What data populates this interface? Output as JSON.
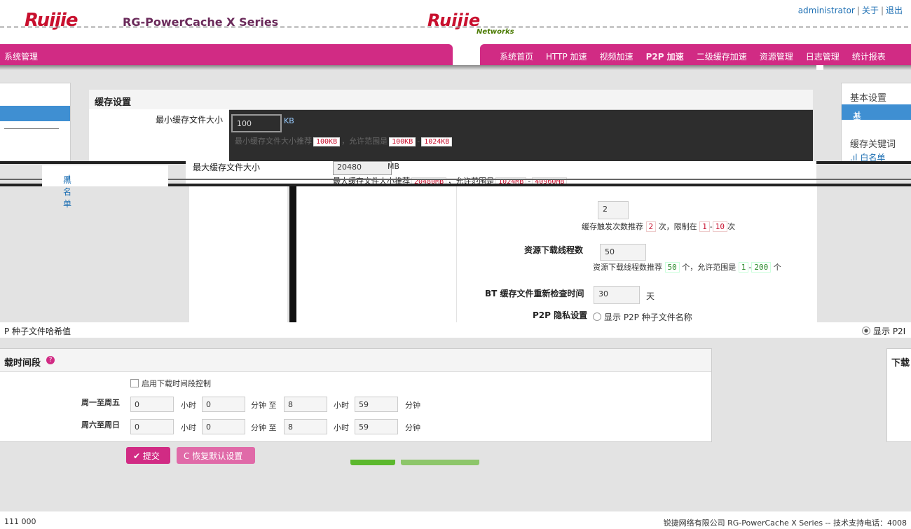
{
  "header": {
    "logo": "Ruijie",
    "product": "RG-PowerCache X Series",
    "brand2": "Ruijie",
    "networks": "Networks",
    "user": "administrator",
    "about": "关于",
    "logout": "退出",
    "sep": "|"
  },
  "nav": {
    "left_title": "系统管理",
    "items": [
      "系统首页",
      "HTTP 加速",
      "视频加速",
      "P2P 加速",
      "二级缓存加速",
      "资源管理",
      "日志管理",
      "统计报表"
    ]
  },
  "left_sidebar": {
    "blacklist": "黑名单"
  },
  "right_sidebar": {
    "basic_heading": "基本设置",
    "basic_selected": "基本设置",
    "keyword_heading": "缓存关键词",
    "whitelist": "白名单",
    "bar_icon": "signal-bars-icon"
  },
  "cache_settings": {
    "title": "缓存设置",
    "min_label": "最小缓存文件大小",
    "min_value": "100",
    "min_unit": "KB",
    "min_hint_prefix": "最小缓存文件大小推荐",
    "min_recommend": "100KB",
    "min_hint_mid": "，允许范围是",
    "min_range_lo": "100KB",
    "min_range_hi": "1024KB",
    "max_label": "最大缓存文件大小",
    "max_value": "20480",
    "max_unit": "MB",
    "max_hint_prefix": "最大缓存文件大小推荐",
    "max_recommend": "20480MB",
    "max_hint_mid": "，允许范围是",
    "max_range_lo": "1024MB",
    "max_range_hi": "40960MB",
    "trigger_value": "2",
    "trigger_hint_prefix": "缓存触发次数推荐",
    "trigger_recommend": "2",
    "trigger_hint_mid": "次，限制在",
    "trigger_lo": "1",
    "trigger_hi": "10",
    "trigger_hint_end": "次",
    "threads_label": "资源下载线程数",
    "threads_value": "50",
    "threads_hint_prefix": "资源下载线程数推荐",
    "threads_recommend": "50",
    "threads_hint_mid": "个，允许范围是",
    "threads_lo": "1",
    "threads_hi": "200",
    "threads_hint_end": "个",
    "bt_label": "BT 缓存文件重新检查时间",
    "bt_value": "30",
    "bt_unit": "天",
    "privacy_label": "P2P 隐私设置",
    "privacy_opt1": "显示 P2P 种子文件名称",
    "privacy_opt2": "P 种子文件哈希值",
    "privacy_opt3": "显示 P2I"
  },
  "download_time": {
    "title": "载时间段",
    "right_title": "下载",
    "enable_label": "启用下载时间段控制",
    "weekday_label": "周一至周五",
    "weekend_label": "周六至周日",
    "hour": "小时",
    "minute": "分钟",
    "to": "分钟 至",
    "weekday": {
      "h1": "0",
      "m1": "0",
      "h2": "8",
      "m2": "59"
    },
    "weekend": {
      "h1": "0",
      "m1": "0",
      "h2": "8",
      "m2": "59"
    }
  },
  "buttons": {
    "submit": "✔ 提交",
    "restore": "C 恢复默认设置"
  },
  "footer": {
    "left": "111 000",
    "right": "锐捷网络有限公司  RG-PowerCache X Series -- 技术支持电话：4008"
  }
}
